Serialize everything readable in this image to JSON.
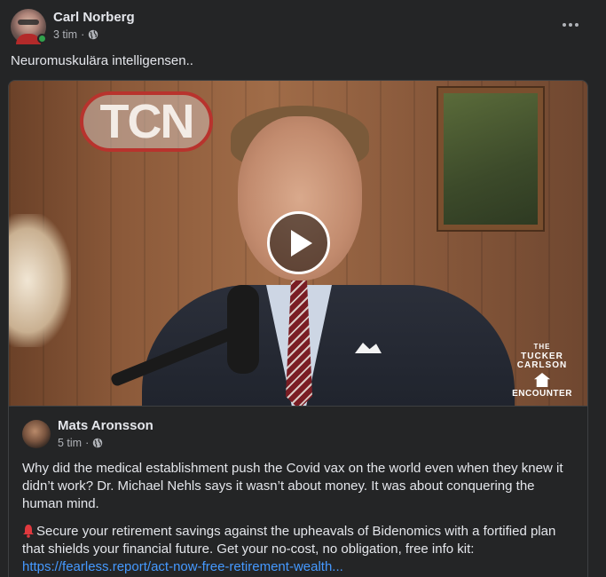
{
  "post": {
    "author": "Carl Norberg",
    "time": "3 tim",
    "separator": "·",
    "text": "Neuromuskulära intelligensen.."
  },
  "video": {
    "sign_text": "TCN",
    "logo": {
      "line1": "THE",
      "line2": "TUCKER CARLSON",
      "line3": "ENCOUNTER"
    }
  },
  "shared": {
    "author": "Mats Aronsson",
    "time": "5 tim",
    "separator": "·",
    "paragraph1": "Why did the medical establishment push the Covid vax on the world even when they knew it didn’t work? Dr. Michael Nehls says it wasn’t about money. It was about conquering the human mind.",
    "paragraph2_text": "Secure your retirement savings against the upheavals of Bidenomics with a fortified plan that shields your financial future. Get your no-cost, no obligation, free info kit:",
    "link": "https://fearless.report/act-now-free-retirement-wealth..."
  },
  "colors": {
    "background": "#242526",
    "text": "#e4e6eb",
    "secondary": "#b0b3b8",
    "link": "#4599ff",
    "online": "#31a24c"
  },
  "icons": [
    "globe-icon",
    "more-options-icon",
    "play-icon",
    "bell-icon"
  ]
}
